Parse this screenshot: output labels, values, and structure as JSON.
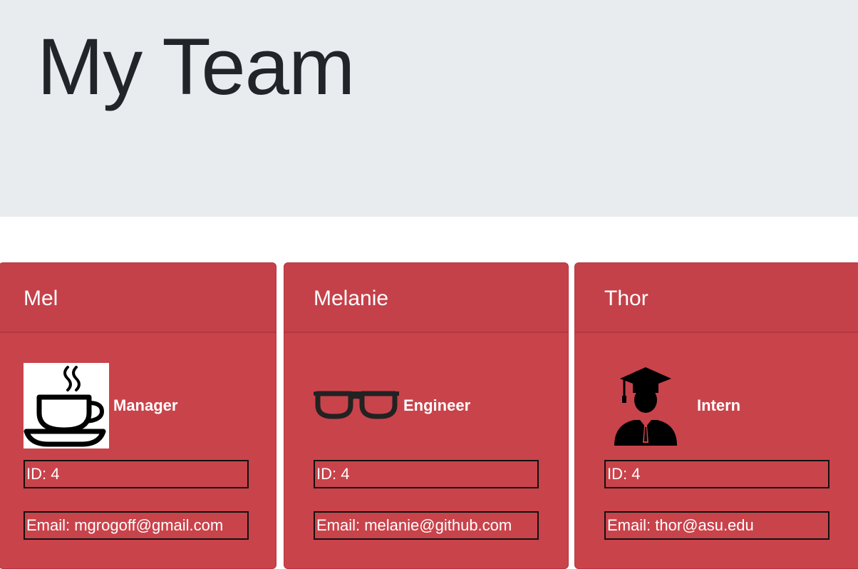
{
  "header": {
    "title": "My Team",
    "background": "#e9ecef"
  },
  "colors": {
    "card_bg": "#c9434b",
    "card_header_bg": "#c4414a",
    "text": "#ffffff"
  },
  "employees": [
    {
      "name": "Mel",
      "role": "Manager",
      "icon": "coffee-cup-icon",
      "id_text": "ID: 4",
      "email_text": "Email: mgrogoff@gmail.com"
    },
    {
      "name": "Melanie",
      "role": "Engineer",
      "icon": "glasses-icon",
      "id_text": "ID: 4",
      "email_text": "Email: melanie@github.com"
    },
    {
      "name": "Thor",
      "role": "Intern",
      "icon": "graduate-icon",
      "id_text": "ID: 4",
      "email_text": "Email: thor@asu.edu"
    }
  ]
}
